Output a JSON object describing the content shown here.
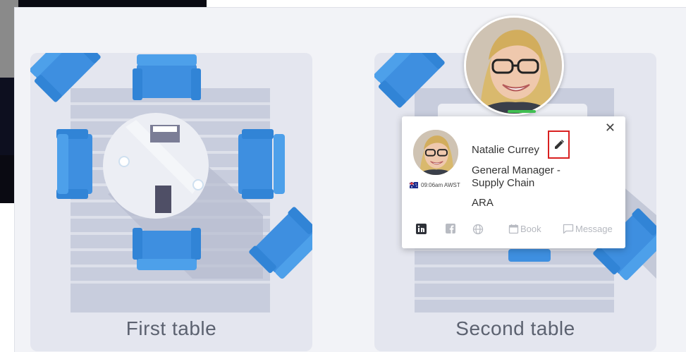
{
  "tables": [
    {
      "label": "First table"
    },
    {
      "label": "Second table"
    }
  ],
  "popover": {
    "name": "Natalie Currey",
    "title": "General Manager - Supply Chain",
    "company": "ARA",
    "timezone": "09:06am AWST",
    "actions": {
      "book_label": "Book",
      "message_label": "Message"
    },
    "icons": [
      "linkedin-icon",
      "facebook-icon",
      "globe-icon",
      "calendar-icon",
      "message-icon",
      "pencil-icon",
      "close-icon"
    ]
  },
  "colors": {
    "chair": "#3e8fe0",
    "floor": "#c6cbdc",
    "floor_line": "#d8dce8",
    "table_top": "#e8eaf1",
    "edit_highlight": "#d92020"
  }
}
